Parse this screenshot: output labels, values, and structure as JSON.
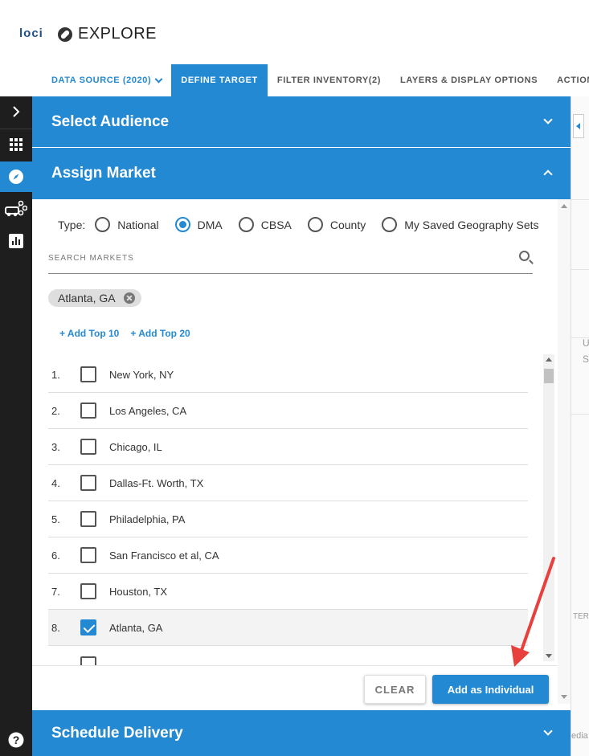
{
  "app": {
    "logo": "loci",
    "title": "EXPLORE"
  },
  "tabs": [
    {
      "label": "DATA SOURCE (2020)"
    },
    {
      "label": "DEFINE TARGET"
    },
    {
      "label": "FILTER INVENTORY(2)"
    },
    {
      "label": "LAYERS & DISPLAY OPTIONS"
    },
    {
      "label": "ACTIONS"
    }
  ],
  "rail": {
    "icons": [
      "chevron-right-icon",
      "grid-icon",
      "compass-icon",
      "vehicles-icon",
      "bar-chart-icon",
      "help-icon"
    ]
  },
  "accordion": {
    "select_audience": "Select Audience",
    "assign_market": "Assign Market",
    "schedule_delivery": "Schedule Delivery"
  },
  "market": {
    "type_label": "Type:",
    "types": [
      {
        "label": "National",
        "checked": false
      },
      {
        "label": "DMA",
        "checked": true
      },
      {
        "label": "CBSA",
        "checked": false
      },
      {
        "label": "County",
        "checked": false
      },
      {
        "label": "My Saved Geography Sets",
        "checked": false
      }
    ],
    "search_placeholder": "SEARCH MARKETS",
    "chip": "Atlanta, GA",
    "add_top_10": "+ Add Top 10",
    "add_top_20": "+ Add Top 20",
    "items": [
      {
        "num": "1.",
        "name": "New York, NY",
        "checked": false
      },
      {
        "num": "2.",
        "name": "Los Angeles, CA",
        "checked": false
      },
      {
        "num": "3.",
        "name": "Chicago, IL",
        "checked": false
      },
      {
        "num": "4.",
        "name": "Dallas-Ft. Worth, TX",
        "checked": false
      },
      {
        "num": "5.",
        "name": "Philadelphia, PA",
        "checked": false
      },
      {
        "num": "6.",
        "name": "San Francisco et al, CA",
        "checked": false
      },
      {
        "num": "7.",
        "name": "Houston, TX",
        "checked": false
      },
      {
        "num": "8.",
        "name": "Atlanta, GA",
        "checked": true
      }
    ]
  },
  "footer": {
    "clear_label": "CLEAR",
    "add_label": "Add as Individual"
  },
  "map_fragments": {
    "u": "U",
    "s": "S",
    "ter": "TER",
    "edia": "edia"
  },
  "colors": {
    "accent": "#2489d3",
    "rail": "#1e1e1e",
    "annotation_arrow": "#e8403c"
  }
}
